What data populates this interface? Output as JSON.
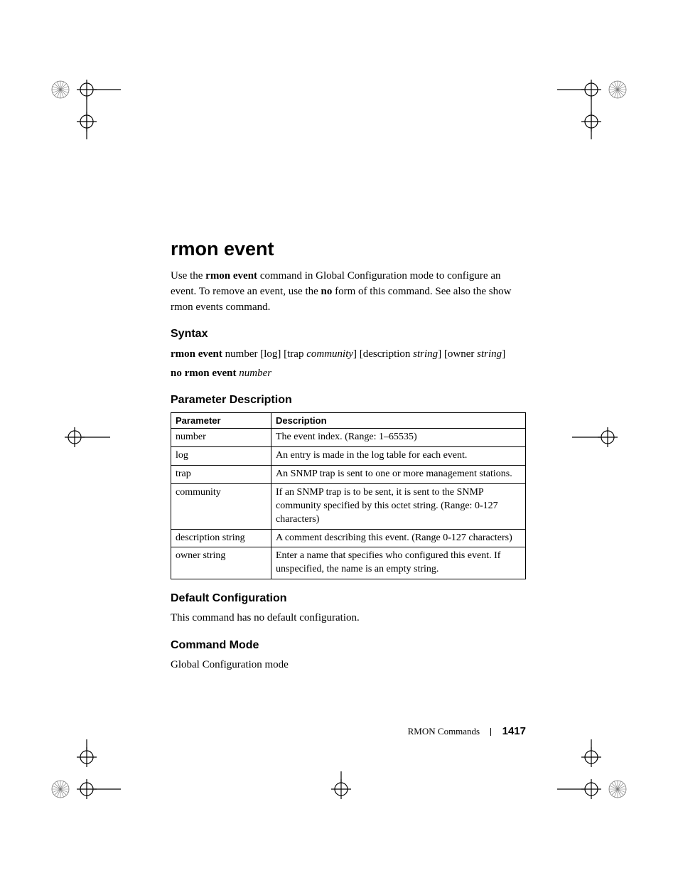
{
  "title": "rmon event",
  "intro": {
    "pre": "Use the ",
    "cmd1": "rmon event",
    "mid1": " command in Global Configuration mode to configure an event. To remove an event, use the ",
    "cmd2": "no",
    "post": " form of this command. See also the show rmon events command."
  },
  "sections": {
    "syntax": "Syntax",
    "param_desc": "Parameter Description",
    "default_cfg": "Default Configuration",
    "cmd_mode": "Command Mode"
  },
  "syntax": {
    "line1": {
      "kw": "rmon event",
      "rest_a": " number [log] [trap ",
      "it_a": "community",
      "rest_b": "] [description ",
      "it_b": "string",
      "rest_c": "] [owner ",
      "it_c": "string",
      "rest_d": "]"
    },
    "line2": {
      "kw": "no rmon event",
      "sp": " ",
      "it": "number"
    }
  },
  "table": {
    "head_param": "Parameter",
    "head_desc": "Description",
    "rows": [
      {
        "p": "number",
        "d": "The event index. (Range: 1–65535)"
      },
      {
        "p": "log",
        "d": "An entry is made in the log table for each event."
      },
      {
        "p": "trap",
        "d": "An SNMP trap is sent to one or more management stations."
      },
      {
        "p": "community",
        "d": "If an SNMP trap is to be sent, it is sent to the SNMP community specified by this octet string. (Range: 0-127 characters)"
      },
      {
        "p": "description string",
        "d": "A comment describing this event. (Range 0-127 characters)"
      },
      {
        "p": "owner string",
        "d": "Enter a name that specifies who configured this event. If unspecified, the name is an empty string."
      }
    ]
  },
  "default_cfg_body": "This command has no default configuration.",
  "cmd_mode_body": "Global Configuration mode",
  "footer": {
    "chapter": "RMON Commands",
    "page": "1417"
  }
}
